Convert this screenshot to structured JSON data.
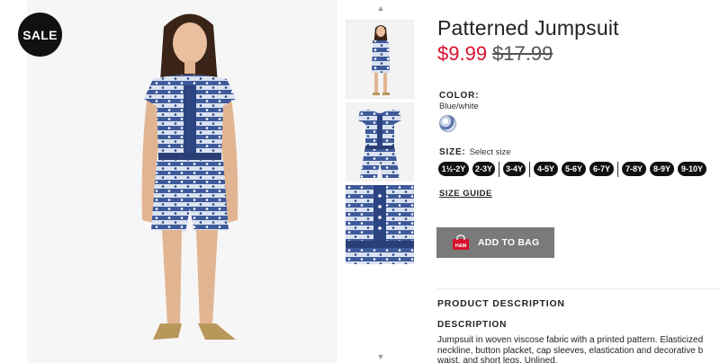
{
  "badge": {
    "label": "SALE"
  },
  "gallery": {
    "main_image": "girl-in-patterned-jumpsuit",
    "arrow_up": "▲",
    "arrow_down": "▼",
    "thumbnails": [
      "model-full-body",
      "jumpsuit-flat-front",
      "jumpsuit-detail-closeup"
    ]
  },
  "product": {
    "title": "Patterned Jumpsuit",
    "price_sale": "$9.99",
    "price_original": "$17.99"
  },
  "color": {
    "label": "COLOR:",
    "value": "Blue/white"
  },
  "size": {
    "label": "SIZE:",
    "hint": "Select size",
    "options": [
      "1½-2Y",
      "2-3Y",
      "3-4Y",
      "4-5Y",
      "5-6Y",
      "6-7Y",
      "7-8Y",
      "8-9Y",
      "9-10Y"
    ],
    "guide_label": "SIZE GUIDE"
  },
  "cart": {
    "add_label": "ADD TO BAG",
    "bag_icon_text": "H&M"
  },
  "description": {
    "section_title": "PRODUCT DESCRIPTION",
    "heading": "DESCRIPTION",
    "lines": [
      "Jumpsuit in woven viscose fabric with a printed pattern. Elasticized",
      "neckline, button placket, cap sleeves, elastication and decorative b",
      "waist, and short legs. Unlined."
    ]
  },
  "colors": {
    "sale_price": "#d8102c",
    "button_bg": "#7a7a7a",
    "badge_bg": "#111111",
    "fabric_blue": "#3e5a9a"
  }
}
